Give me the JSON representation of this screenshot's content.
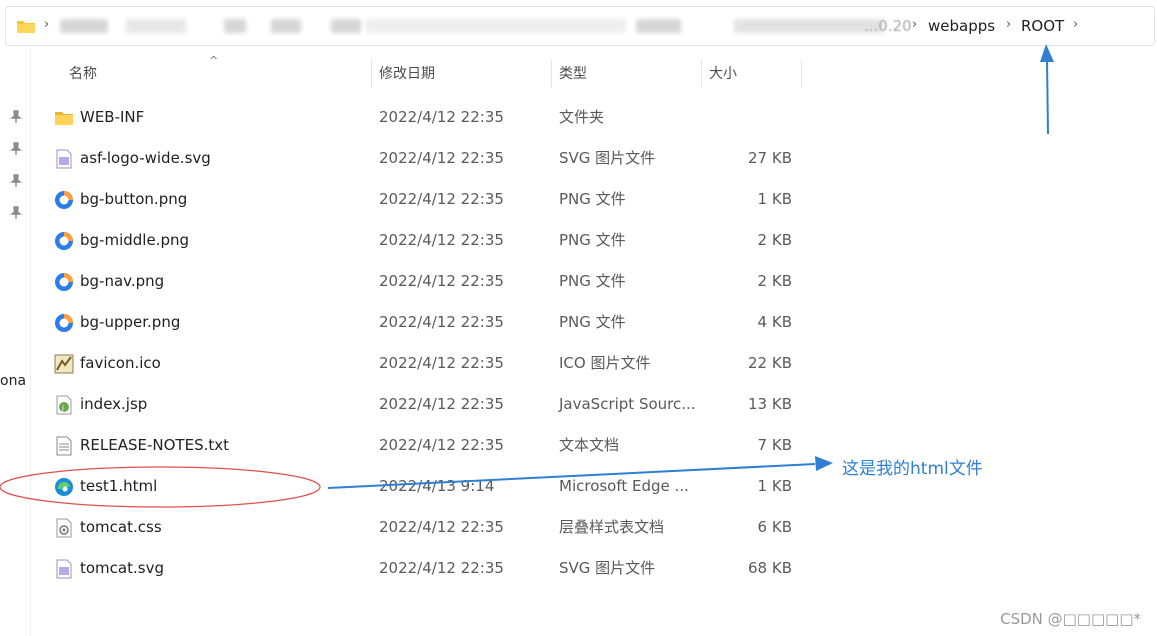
{
  "address_bar": {
    "breadcrumbs": [
      "webapps",
      "ROOT"
    ],
    "partial_segment": "...0.20"
  },
  "left_nav": {
    "cut_label": "ona"
  },
  "columns": {
    "name": "名称",
    "date": "修改日期",
    "type": "类型",
    "size": "大小"
  },
  "files": [
    {
      "name": "WEB-INF",
      "date": "2022/4/12 22:35",
      "type": "文件夹",
      "size": "",
      "icon": "folder-icon"
    },
    {
      "name": "asf-logo-wide.svg",
      "date": "2022/4/12 22:35",
      "type": "SVG 图片文件",
      "size": "27 KB",
      "icon": "svg-file-icon"
    },
    {
      "name": "bg-button.png",
      "date": "2022/4/12 22:35",
      "type": "PNG 文件",
      "size": "1 KB",
      "icon": "png-file-icon"
    },
    {
      "name": "bg-middle.png",
      "date": "2022/4/12 22:35",
      "type": "PNG 文件",
      "size": "2 KB",
      "icon": "png-file-icon"
    },
    {
      "name": "bg-nav.png",
      "date": "2022/4/12 22:35",
      "type": "PNG 文件",
      "size": "2 KB",
      "icon": "png-file-icon"
    },
    {
      "name": "bg-upper.png",
      "date": "2022/4/12 22:35",
      "type": "PNG 文件",
      "size": "4 KB",
      "icon": "png-file-icon"
    },
    {
      "name": "favicon.ico",
      "date": "2022/4/12 22:35",
      "type": "ICO 图片文件",
      "size": "22 KB",
      "icon": "ico-file-icon"
    },
    {
      "name": "index.jsp",
      "date": "2022/4/12 22:35",
      "type": "JavaScript Sourc...",
      "size": "13 KB",
      "icon": "jsp-file-icon"
    },
    {
      "name": "RELEASE-NOTES.txt",
      "date": "2022/4/12 22:35",
      "type": "文本文档",
      "size": "7 KB",
      "icon": "txt-file-icon"
    },
    {
      "name": "test1.html",
      "date": "2022/4/13 9:14",
      "type": "Microsoft Edge ...",
      "size": "1 KB",
      "icon": "edge-file-icon"
    },
    {
      "name": "tomcat.css",
      "date": "2022/4/12 22:35",
      "type": "层叠样式表文档",
      "size": "6 KB",
      "icon": "css-file-icon"
    },
    {
      "name": "tomcat.svg",
      "date": "2022/4/12 22:35",
      "type": "SVG 图片文件",
      "size": "68 KB",
      "icon": "svg-file-icon"
    }
  ],
  "annotation": {
    "note": "这是我的html文件",
    "color": "#2f7fd4",
    "ellipse_color": "#e05050"
  },
  "watermark": "CSDN @□□□□□*"
}
